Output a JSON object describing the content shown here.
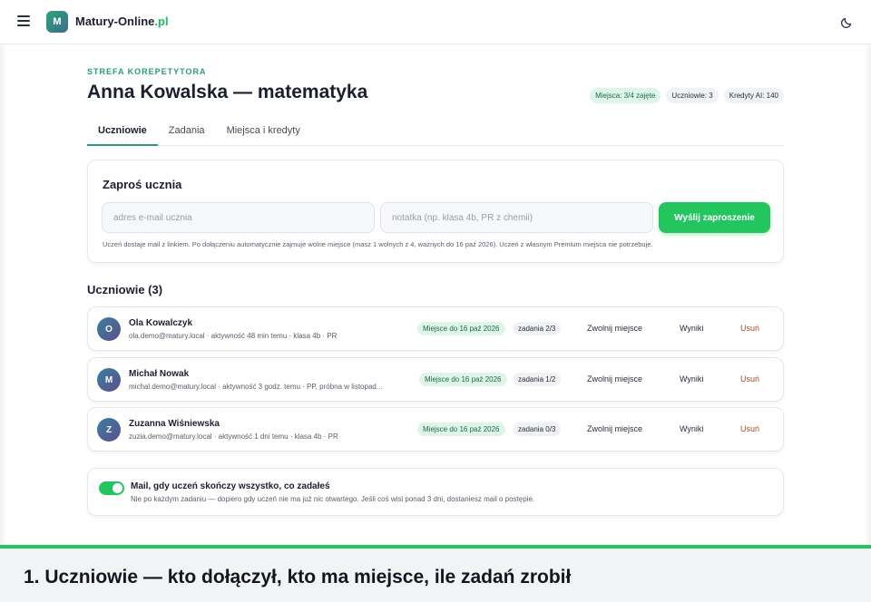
{
  "header": {
    "logo_letter": "M",
    "brand_name": "Matury-Online",
    "brand_tld": ".pl"
  },
  "eyebrow": "STREFA KOREPETYTORA",
  "page_title": "Anna Kowalska — matematyka",
  "chips": [
    "Miejsca: 3/4 zajęte",
    "Uczniowie: 3",
    "Kredyty AI: 140"
  ],
  "tabs": [
    "Uczniowie",
    "Zadania",
    "Miejsca i kredyty"
  ],
  "invite": {
    "title": "Zaproś ucznia",
    "email_placeholder": "adres e-mail ucznia",
    "note_placeholder": "notatka (np. klasa 4b, PR z chemii)",
    "send_label": "Wyślij zaproszenie",
    "hint": "Uczeń dostaje mail z linkiem. Po dołączeniu automatycznie zajmuje wolne miejsce (masz 1 wolnych z 4, ważnych do 16 paź 2026). Uczeń z własnym Premium miejsca nie potrzebuje."
  },
  "students_title": "Uczniowie (3)",
  "students": [
    {
      "initial": "O",
      "name": "Ola Kowalczyk",
      "meta": "ola.demo@matury.local · aktywność 48 min temu · klasa 4b · PR",
      "place": "Miejsce do 16 paź 2026",
      "tasks": "zadania 2/3",
      "free": "Zwolnij miejsce",
      "results": "Wyniki",
      "remove": "Usuń"
    },
    {
      "initial": "M",
      "name": "Michał Nowak",
      "meta": "michal.demo@matury.local · aktywność 3 godz. temu · PP, próbna w listopad...",
      "place": "Miejsce do 16 paź 2026",
      "tasks": "zadania 1/2",
      "free": "Zwolnij miejsce",
      "results": "Wyniki",
      "remove": "Usuń"
    },
    {
      "initial": "Z",
      "name": "Zuzanna Wiśniewska",
      "meta": "zuzia.demo@matury.local · aktywność 1 dni temu · klasa 4b · PR",
      "place": "Miejsce do 16 paź 2026",
      "tasks": "zadania 0/3",
      "free": "Zwolnij miejsce",
      "results": "Wyniki",
      "remove": "Usuń"
    }
  ],
  "mail_setting": {
    "title": "Mail, gdy uczeń skończy wszystko, co zadałeś",
    "desc": "Nie po każdym zadaniu — dopiero gdy uczeń nie ma już nic otwartego. Jeśli coś wisi ponad 3 dni, dostaniesz mail o postępie.",
    "enabled": true
  },
  "caption": "1. Uczniowie — kto dołączył, kto ma miejsce, ile zadań zrobił",
  "colors": {
    "accent": "#22c55e",
    "eyebrow": "#2a9d6b",
    "remove": "#a44a2a"
  }
}
